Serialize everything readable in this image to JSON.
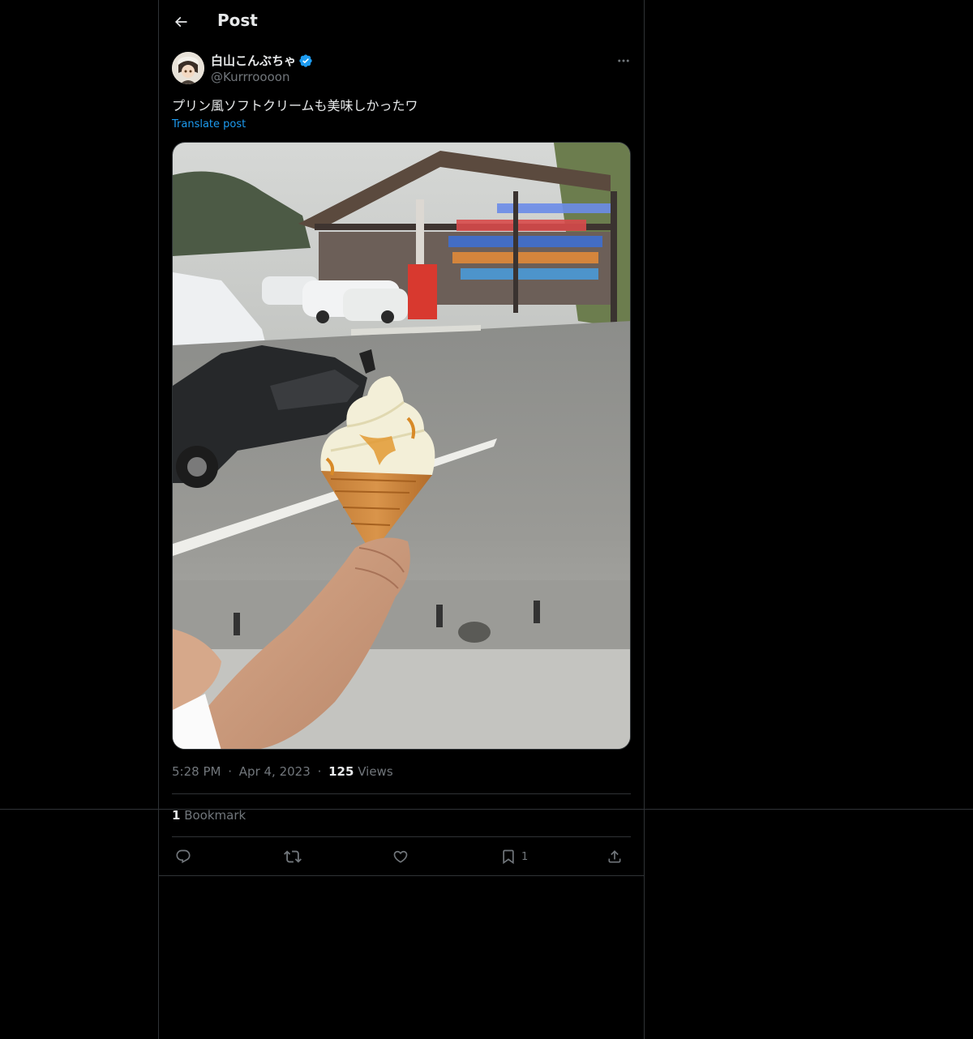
{
  "header": {
    "title": "Post",
    "back_icon": "arrow-left-icon"
  },
  "author": {
    "display_name": "白山こんぶちゃ",
    "handle": "@Kurrroooon",
    "verified_icon": "verified-badge-icon",
    "verified_color": "#1d9bf0"
  },
  "post": {
    "text": "プリン風ソフトクリームも美味しかったワ",
    "translate_label": "Translate post",
    "media_description_icon": "photo-icon"
  },
  "meta": {
    "time": "5:28 PM",
    "separator": "·",
    "date": "Apr 4, 2023",
    "views_count": "125",
    "views_label": "Views"
  },
  "stats": {
    "bookmark_count": "1",
    "bookmark_label": "Bookmark"
  },
  "actions": {
    "reply_icon": "reply-icon",
    "repost_icon": "repost-icon",
    "like_icon": "heart-icon",
    "bookmark_icon": "bookmark-icon",
    "bookmark_count": "1",
    "share_icon": "share-icon"
  },
  "colors": {
    "background": "#000000",
    "text_primary": "#e7e9ea",
    "text_secondary": "#71767b",
    "accent": "#1d9bf0",
    "border": "#2f3336"
  }
}
